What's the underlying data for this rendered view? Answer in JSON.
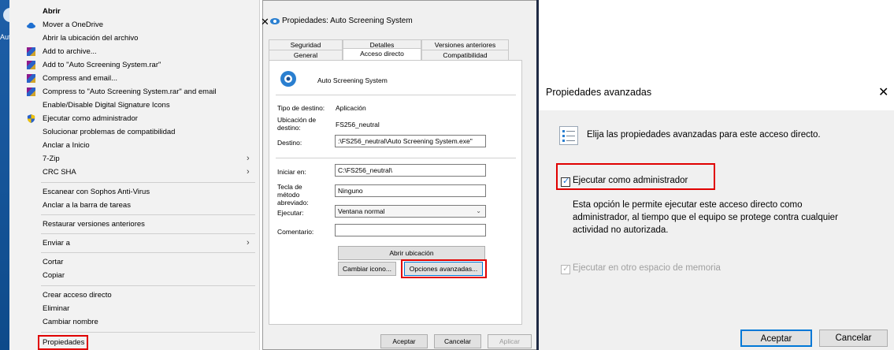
{
  "desktop": {
    "label": "Auto"
  },
  "context_menu": {
    "items": [
      {
        "label": "Abrir",
        "bold": true
      },
      {
        "label": "Mover a OneDrive",
        "icon": "onedrive-icon"
      },
      {
        "label": "Abrir la ubicación del archivo"
      },
      {
        "label": "Add to archive...",
        "icon": "winrar-icon"
      },
      {
        "label": "Add to \"Auto Screening System.rar\"",
        "icon": "winrar-icon"
      },
      {
        "label": "Compress and email...",
        "icon": "winrar-icon"
      },
      {
        "label": "Compress to \"Auto Screening System.rar\" and email",
        "icon": "winrar-icon"
      },
      {
        "label": "Enable/Disable Digital Signature Icons"
      },
      {
        "label": "Ejecutar como administrador",
        "icon": "shield-icon"
      },
      {
        "label": "Solucionar problemas de compatibilidad"
      },
      {
        "label": "Anclar a Inicio"
      },
      {
        "label": "7-Zip",
        "submenu": true
      },
      {
        "label": "CRC SHA",
        "submenu": true
      },
      {
        "label": "Escanear con Sophos Anti-Virus"
      },
      {
        "label": "Anclar a la barra de tareas"
      },
      {
        "label": "Restaurar versiones anteriores"
      },
      {
        "label": "Enviar a",
        "submenu": true
      },
      {
        "label": "Cortar"
      },
      {
        "label": "Copiar"
      },
      {
        "label": "Crear acceso directo"
      },
      {
        "label": "Eliminar"
      },
      {
        "label": "Cambiar nombre"
      },
      {
        "label": "Propiedades"
      }
    ]
  },
  "properties": {
    "title": "Propiedades: Auto Screening System",
    "tabs_row1": [
      "Seguridad",
      "Detalles",
      "Versiones anteriores"
    ],
    "tabs_row2": [
      "General",
      "Acceso directo",
      "Compatibilidad"
    ],
    "app_name": "Auto Screening System",
    "tipo_label": "Tipo de destino:",
    "tipo_value": "Aplicación",
    "ubicacion_label": "Ubicación de destino:",
    "ubicacion_value": "FS256_neutral",
    "destino_label": "Destino:",
    "destino_value": ":\\FS256_neutral\\Auto Screening System.exe\"",
    "iniciar_label": "Iniciar en:",
    "iniciar_value": "C:\\FS256_neutral\\",
    "tecla_label": "Tecla de método abreviado:",
    "tecla_value": "Ninguno",
    "ejecutar_label": "Ejecutar:",
    "ejecutar_value": "Ventana normal",
    "comentario_label": "Comentario:",
    "comentario_value": "",
    "btn_abrir": "Abrir ubicación",
    "btn_cambiar": "Cambiar icono...",
    "btn_opciones": "Opciones avanzadas...",
    "btn_aceptar": "Aceptar",
    "btn_cancelar": "Cancelar",
    "btn_aplicar": "Aplicar"
  },
  "advanced": {
    "title": "Propiedades avanzadas",
    "description": "Elija las propiedades avanzadas para este acceso directo.",
    "run_as_admin_label": "Ejecutar como administrador",
    "run_as_admin_checked": true,
    "help_text_line1": "Esta opción le permite ejecutar este acceso directo como",
    "help_text_line2": "administrador, al tiempo que el equipo se protege contra cualquier",
    "help_text_line3": "actividad no autorizada.",
    "separate_memory_label": "Ejecutar en otro espacio de memoria",
    "separate_memory_checked": true,
    "separate_memory_enabled": false,
    "btn_aceptar": "Aceptar",
    "btn_cancelar": "Cancelar"
  },
  "colors": {
    "highlight": "#e00000",
    "accent": "#0078d7"
  }
}
